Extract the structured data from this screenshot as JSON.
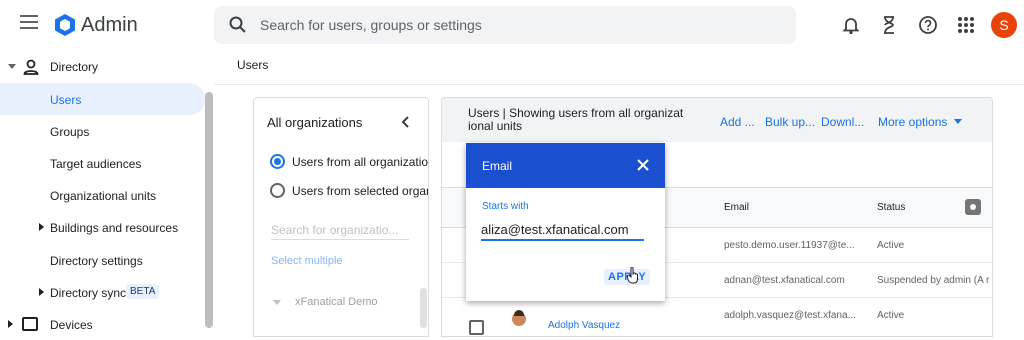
{
  "app": {
    "title": "Admin"
  },
  "search": {
    "placeholder": "Search for users, groups or settings"
  },
  "top_icons": [
    "bell-icon",
    "hourglass-icon",
    "help-icon",
    "apps-grid-icon"
  ],
  "user": {
    "avatar_letter": "S",
    "avatar_color": "#e8430a"
  },
  "sidebar": {
    "section": "Directory",
    "items": [
      {
        "label": "Users",
        "active": true
      },
      {
        "label": "Groups"
      },
      {
        "label": "Target audiences"
      },
      {
        "label": "Organizational units"
      },
      {
        "label": "Buildings and resources",
        "expandable": true
      },
      {
        "label": "Directory settings"
      },
      {
        "label": "Directory sync",
        "expandable": true,
        "badge": "BETA"
      },
      {
        "label": "Devices",
        "expandable": true
      }
    ]
  },
  "breadcrumb": "Users",
  "org_panel": {
    "title": "All organizations",
    "radio_all": "Users from all organization",
    "radio_selected": "Users from selected organ",
    "search_placeholder": "Search for organizatio...",
    "select_multiple": "Select multiple",
    "tree_root": "xFanatical Demo"
  },
  "users_panel": {
    "title": "Users | Showing users from all organizat ional units",
    "actions": [
      "Add ...",
      "Bulk up...",
      "Downl...",
      "More options"
    ],
    "columns": {
      "email": "Email",
      "status": "Status"
    },
    "rows": [
      {
        "email": "pesto.demo.user.11937@te...",
        "status": "Active"
      },
      {
        "email": "adnan@test.xfanatical.com",
        "status": "Suspended by admin (A r"
      },
      {
        "name": "Adolph Vasquez",
        "email": "adolph.vasquez@test.xfana...",
        "status": "Active"
      }
    ]
  },
  "email_filter": {
    "title": "Email",
    "field_label": "Starts with",
    "value": "aliza@test.xfanatical.com",
    "apply": "APPLY"
  },
  "colors": {
    "accent": "#1a73e8",
    "dialog_header": "#1a4fd0"
  }
}
